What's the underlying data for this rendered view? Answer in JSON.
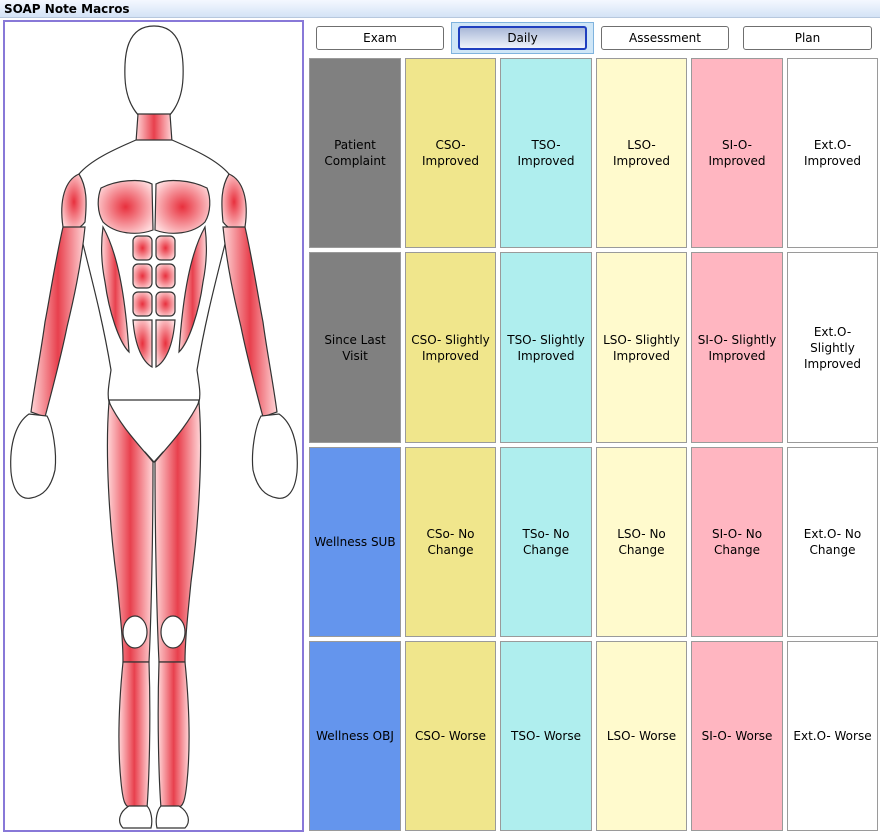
{
  "window": {
    "title": "SOAP Note Macros"
  },
  "tabs": [
    {
      "label": "Exam"
    },
    {
      "label": "Daily"
    },
    {
      "label": "Assessment"
    },
    {
      "label": "Plan"
    }
  ],
  "active_tab": "Daily",
  "colors": {
    "header_gray": "#808080",
    "header_blue": "#6495ed",
    "khaki": "#f0e68c",
    "cyan": "#afeeee",
    "cream": "#fffacd",
    "pink": "#ffb6c1",
    "white": "#ffffff",
    "muscle": "#e8505a",
    "panel_border": "#8878d8"
  },
  "illustration": {
    "icon": "human-anatomy-muscle-figure"
  },
  "grid": {
    "rows": [
      {
        "header": "Patient Complaint",
        "cells": [
          "CSO- Improved",
          "TSO- Improved",
          "LSO- Improved",
          "SI-O- Improved",
          "Ext.O- Improved"
        ]
      },
      {
        "header": "Since Last Visit",
        "cells": [
          "CSO- Slightly Improved",
          "TSO- Slightly Improved",
          "LSO- Slightly Improved",
          "SI-O- Slightly Improved",
          "Ext.O- Slightly Improved"
        ]
      },
      {
        "header": "Wellness SUB",
        "cells": [
          "CSo- No Change",
          "TSo- No Change",
          "LSO- No Change",
          "SI-O- No Change",
          "Ext.O- No Change"
        ]
      },
      {
        "header": "Wellness OBJ",
        "cells": [
          "CSO- Worse",
          "TSO- Worse",
          "LSO- Worse",
          "SI-O- Worse",
          "Ext.O- Worse"
        ]
      }
    ]
  }
}
